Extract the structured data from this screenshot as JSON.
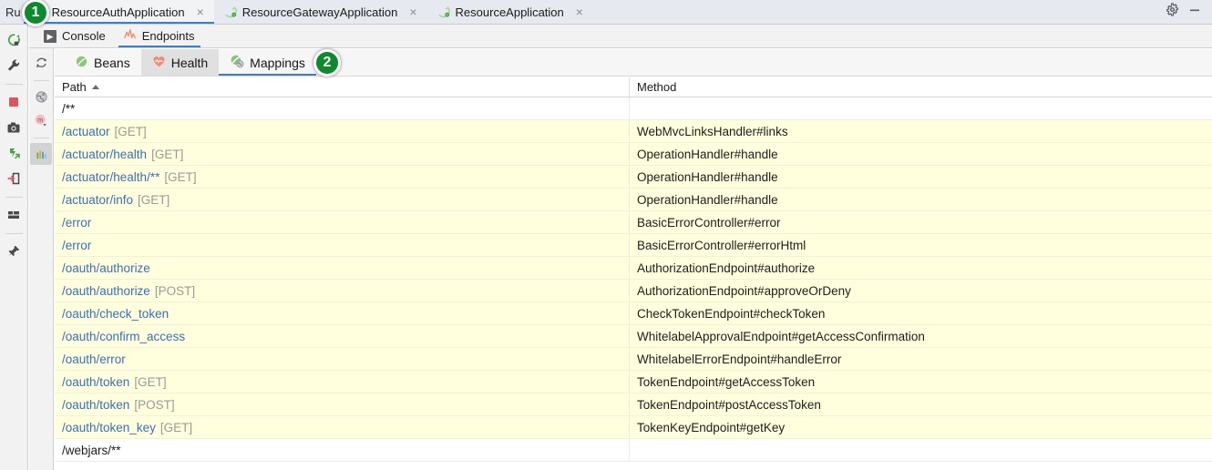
{
  "window": {
    "run_label": "Ru",
    "gear_icon": "gear-icon",
    "minimize_icon": "minimize-icon"
  },
  "run_tabs": [
    {
      "label": "ResourceAuthApplication",
      "icon": "spring-boot-icon",
      "close": "×",
      "active": true
    },
    {
      "label": "ResourceGatewayApplication",
      "icon": "spring-boot-icon",
      "close": "×",
      "active": false
    },
    {
      "label": "ResourceApplication",
      "icon": "spring-boot-icon",
      "close": "×",
      "active": false
    }
  ],
  "console_tabs": [
    {
      "label": "Console",
      "icon": "console-icon",
      "active": false
    },
    {
      "label": "Endpoints",
      "icon": "endpoints-icon",
      "active": true
    }
  ],
  "endpoint_tabs": [
    {
      "label": "Beans",
      "icon": "beans-icon",
      "active": false,
      "hover": false
    },
    {
      "label": "Health",
      "icon": "health-icon",
      "active": false,
      "hover": true
    },
    {
      "label": "Mappings",
      "icon": "mappings-icon",
      "active": true,
      "hover": false
    }
  ],
  "left_toolbar": [
    {
      "icon": "rerun-icon"
    },
    {
      "icon": "wrench-icon"
    },
    {
      "icon": "separator"
    },
    {
      "icon": "stop-icon"
    },
    {
      "icon": "camera-icon"
    },
    {
      "icon": "thread-dump-icon"
    },
    {
      "icon": "exit-icon"
    },
    {
      "icon": "separator"
    },
    {
      "icon": "layout-icon"
    },
    {
      "icon": "separator"
    },
    {
      "icon": "pin-icon"
    }
  ],
  "left_toolbar_2": [
    {
      "icon": "refresh-icon",
      "selected": false
    },
    {
      "icon": "separator",
      "selected": false
    },
    {
      "icon": "globe-icon",
      "selected": false
    },
    {
      "icon": "mappings-m-icon",
      "selected": false
    },
    {
      "icon": "separator",
      "selected": false
    },
    {
      "icon": "metrics-icon",
      "selected": true
    }
  ],
  "table": {
    "columns": [
      {
        "label": "Path",
        "sorted": true,
        "sort_dir": "asc"
      },
      {
        "label": "Method",
        "sorted": false,
        "sort_dir": ""
      }
    ],
    "rows": [
      {
        "path": "/**",
        "verb": "",
        "method": "",
        "style": "plain"
      },
      {
        "path": "/actuator",
        "verb": "[GET]",
        "method": "WebMvcLinksHandler#links",
        "style": "hl"
      },
      {
        "path": "/actuator/health",
        "verb": "[GET]",
        "method": "OperationHandler#handle",
        "style": "hl"
      },
      {
        "path": "/actuator/health/**",
        "verb": "[GET]",
        "method": "OperationHandler#handle",
        "style": "hl"
      },
      {
        "path": "/actuator/info",
        "verb": "[GET]",
        "method": "OperationHandler#handle",
        "style": "hl"
      },
      {
        "path": "/error",
        "verb": "",
        "method": "BasicErrorController#error",
        "style": "hl"
      },
      {
        "path": "/error",
        "verb": "",
        "method": "BasicErrorController#errorHtml",
        "style": "hl"
      },
      {
        "path": "/oauth/authorize",
        "verb": "",
        "method": "AuthorizationEndpoint#authorize",
        "style": "hl"
      },
      {
        "path": "/oauth/authorize",
        "verb": "[POST]",
        "method": "AuthorizationEndpoint#approveOrDeny",
        "style": "hl"
      },
      {
        "path": "/oauth/check_token",
        "verb": "",
        "method": "CheckTokenEndpoint#checkToken",
        "style": "hl"
      },
      {
        "path": "/oauth/confirm_access",
        "verb": "",
        "method": "WhitelabelApprovalEndpoint#getAccessConfirmation",
        "style": "hl"
      },
      {
        "path": "/oauth/error",
        "verb": "",
        "method": "WhitelabelErrorEndpoint#handleError",
        "style": "hl"
      },
      {
        "path": "/oauth/token",
        "verb": "[GET]",
        "method": "TokenEndpoint#getAccessToken",
        "style": "hl"
      },
      {
        "path": "/oauth/token",
        "verb": "[POST]",
        "method": "TokenEndpoint#postAccessToken",
        "style": "hl"
      },
      {
        "path": "/oauth/token_key",
        "verb": "[GET]",
        "method": "TokenKeyEndpoint#getKey",
        "style": "hl"
      },
      {
        "path": "/webjars/**",
        "verb": "",
        "method": "",
        "style": "plain"
      }
    ]
  },
  "annotations": [
    {
      "id": "1",
      "label": "1"
    },
    {
      "id": "2",
      "label": "2"
    }
  ],
  "colors": {
    "accent": "#3d7dc9",
    "row_highlight": "#ffffdd",
    "link": "#3a6fb5",
    "badge": "#0e8a2e",
    "verb": "#9a9a9a"
  }
}
